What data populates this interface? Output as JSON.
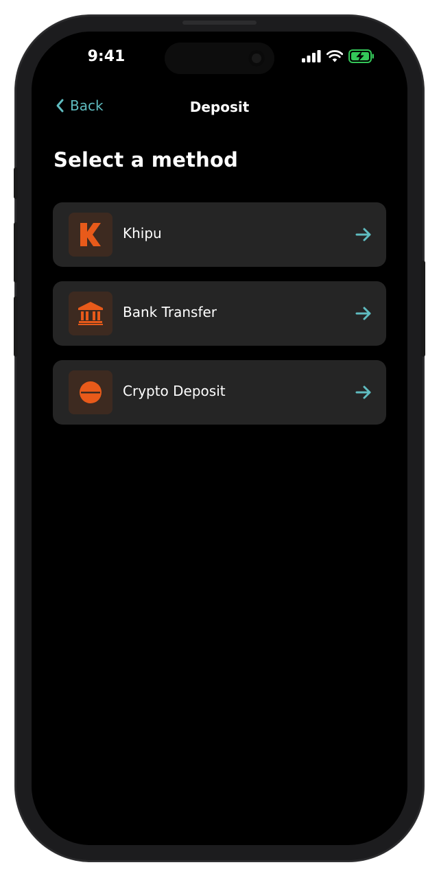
{
  "status_bar": {
    "time": "9:41"
  },
  "nav": {
    "back_label": "Back",
    "title": "Deposit"
  },
  "heading": "Select a method",
  "methods": [
    {
      "label": "Khipu",
      "icon": "khipu-logo-icon"
    },
    {
      "label": "Bank Transfer",
      "icon": "bank-icon"
    },
    {
      "label": "Crypto Deposit",
      "icon": "crypto-icon"
    }
  ],
  "colors": {
    "accent": "#5fbcc0",
    "brand_orange": "#e85a1a",
    "card_bg": "#252525",
    "icon_bg": "#3d2a20",
    "battery_green": "#34c759"
  }
}
